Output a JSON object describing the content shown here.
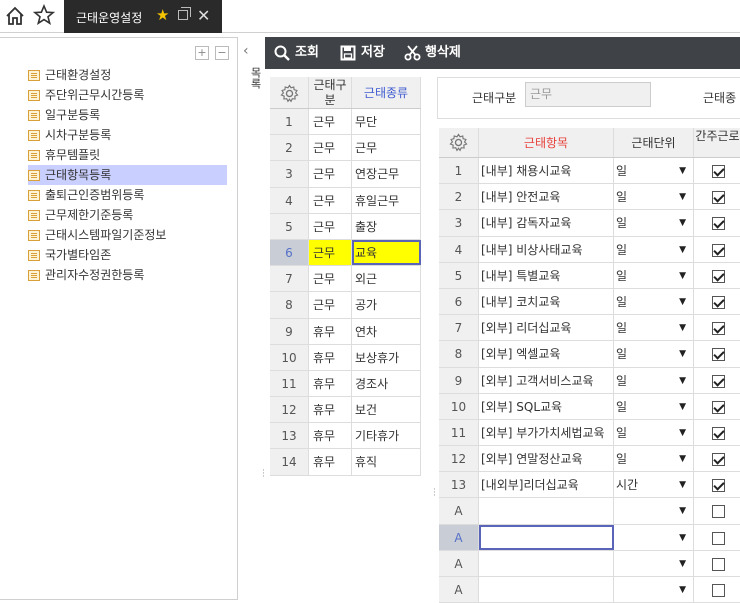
{
  "topbar": {
    "home_icon": "home-icon",
    "star_icon": "star-outline-icon",
    "tab_label": "근태운영설정",
    "star_glyph": "★",
    "close_glyph": "✕"
  },
  "tree": {
    "expand_glyph": "+",
    "collapse_glyph": "−",
    "items": [
      {
        "label": "근태환경설정",
        "selected": false
      },
      {
        "label": "주단위근무시간등록",
        "selected": false
      },
      {
        "label": "일구분등록",
        "selected": false
      },
      {
        "label": "시차구분등록",
        "selected": false
      },
      {
        "label": "휴무템플릿",
        "selected": false
      },
      {
        "label": "근태항목등록",
        "selected": true
      },
      {
        "label": "출퇴근인증범위등록",
        "selected": false
      },
      {
        "label": "근무제한기준등록",
        "selected": false
      },
      {
        "label": "근태시스템파일기준정보",
        "selected": false
      },
      {
        "label": "국가별타임존",
        "selected": false
      },
      {
        "label": "관리자수정권한등록",
        "selected": false
      }
    ]
  },
  "side_toggle": {
    "arrow": "‹",
    "label": "목록"
  },
  "toolbar": {
    "search_label": "조회",
    "save_label": "저장",
    "delete_label": "행삭제"
  },
  "grid1": {
    "headers": {
      "division": "근태구분",
      "kind": "근태종류"
    },
    "rows": [
      {
        "no": "1",
        "division": "근무",
        "kind": "무단"
      },
      {
        "no": "2",
        "division": "근무",
        "kind": "근무"
      },
      {
        "no": "3",
        "division": "근무",
        "kind": "연장근무"
      },
      {
        "no": "4",
        "division": "근무",
        "kind": "휴일근무"
      },
      {
        "no": "5",
        "division": "근무",
        "kind": "출장"
      },
      {
        "no": "6",
        "division": "근무",
        "kind": "교육",
        "selected": true
      },
      {
        "no": "7",
        "division": "근무",
        "kind": "외근"
      },
      {
        "no": "8",
        "division": "근무",
        "kind": "공가"
      },
      {
        "no": "9",
        "division": "휴무",
        "kind": "연차"
      },
      {
        "no": "10",
        "division": "휴무",
        "kind": "보상휴가"
      },
      {
        "no": "11",
        "division": "휴무",
        "kind": "경조사"
      },
      {
        "no": "12",
        "division": "휴무",
        "kind": "보건"
      },
      {
        "no": "13",
        "division": "휴무",
        "kind": "기타휴가"
      },
      {
        "no": "14",
        "division": "휴무",
        "kind": "휴직"
      }
    ]
  },
  "filter": {
    "division_label": "근태구분",
    "division_value": "근무",
    "kind_label": "근태종"
  },
  "grid2": {
    "headers": {
      "item": "근태항목",
      "unit": "근태단위",
      "deemed": "간주근로"
    },
    "dropdown_glyph": "▼",
    "rows": [
      {
        "no": "1",
        "item": "[내부] 채용시교육",
        "unit": "일",
        "checked": true
      },
      {
        "no": "2",
        "item": "[내부] 안전교육",
        "unit": "일",
        "checked": true
      },
      {
        "no": "3",
        "item": "[내부] 감독자교육",
        "unit": "일",
        "checked": true
      },
      {
        "no": "4",
        "item": "[내부] 비상사태교육",
        "unit": "일",
        "checked": true
      },
      {
        "no": "5",
        "item": "[내부] 특별교육",
        "unit": "일",
        "checked": true
      },
      {
        "no": "6",
        "item": "[내부] 코치교육",
        "unit": "일",
        "checked": true
      },
      {
        "no": "7",
        "item": "[외부] 리더십교육",
        "unit": "일",
        "checked": true
      },
      {
        "no": "8",
        "item": "[외부] 엑셀교육",
        "unit": "일",
        "checked": true
      },
      {
        "no": "9",
        "item": "[외부] 고객서비스교육",
        "unit": "일",
        "checked": true
      },
      {
        "no": "10",
        "item": "[외부] SQL교육",
        "unit": "일",
        "checked": true
      },
      {
        "no": "11",
        "item": "[외부] 부가가치세법교육",
        "unit": "일",
        "checked": true
      },
      {
        "no": "12",
        "item": "[외부] 연말정산교육",
        "unit": "일",
        "checked": true
      },
      {
        "no": "13",
        "item": "[내외부]리더십교육",
        "unit": "시간",
        "checked": true
      },
      {
        "no": "A",
        "item": "",
        "unit": "",
        "checked": false
      },
      {
        "no": "A",
        "item": "",
        "unit": "",
        "checked": false,
        "selected": true
      },
      {
        "no": "A",
        "item": "",
        "unit": "",
        "checked": false
      },
      {
        "no": "A",
        "item": "",
        "unit": "",
        "checked": false
      }
    ]
  },
  "colors": {
    "toolbar": "#3f4246",
    "tab": "#2a2a2a",
    "selection": "#c9cfff",
    "highlight": "#ffff00",
    "required": "#e8413c",
    "header_link": "#3f5bd0"
  }
}
